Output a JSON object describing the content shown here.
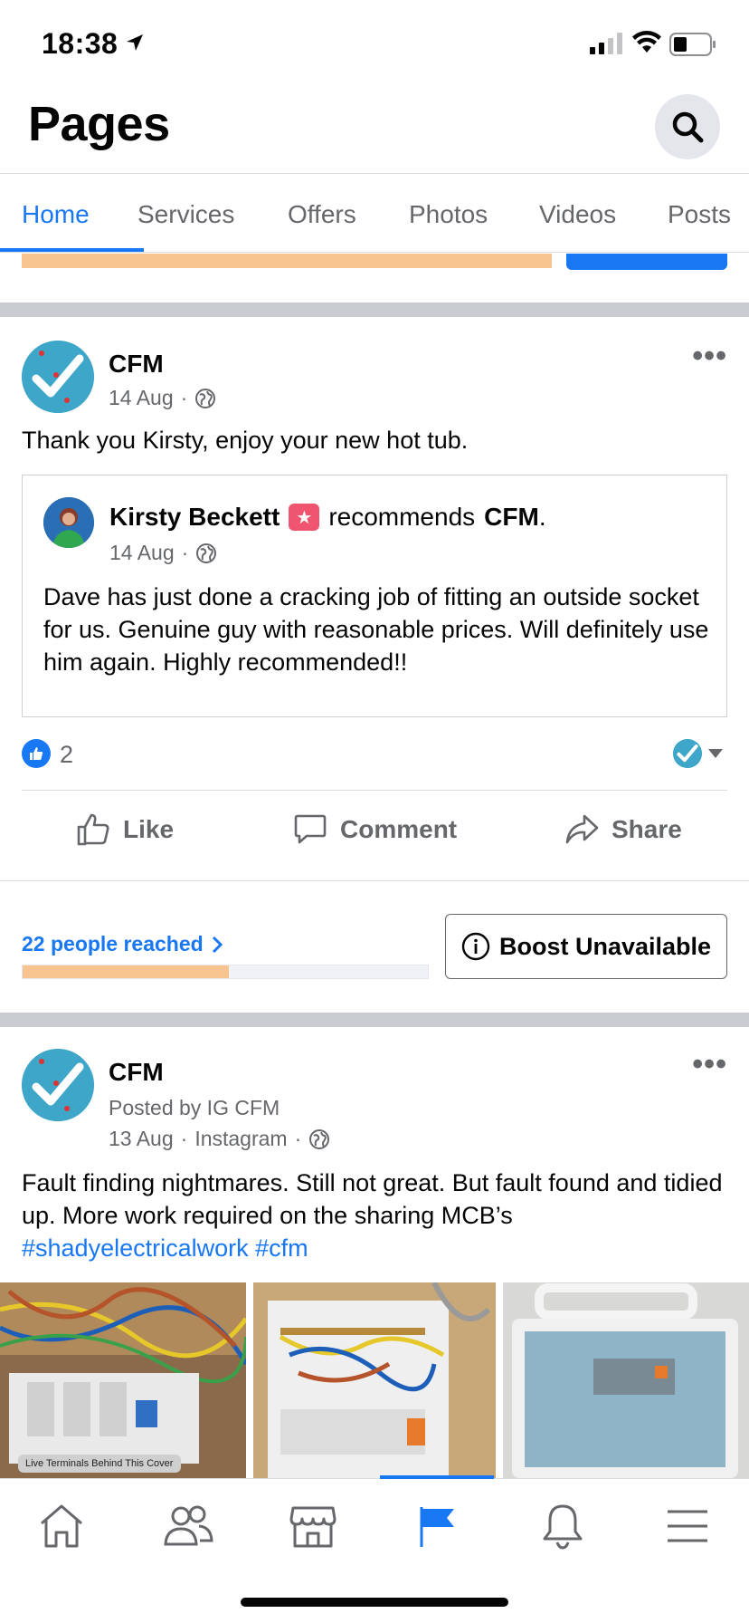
{
  "status_bar": {
    "time": "18:38"
  },
  "header": {
    "title": "Pages"
  },
  "tabs": [
    {
      "label": "Home"
    },
    {
      "label": "Services"
    },
    {
      "label": "Offers"
    },
    {
      "label": "Photos"
    },
    {
      "label": "Videos"
    },
    {
      "label": "Posts"
    }
  ],
  "post1": {
    "author": "CFM",
    "date": "14 Aug",
    "text": "Thank you Kirsty, enjoy your new hot tub.",
    "recommendation": {
      "name": "Kirsty Beckett",
      "verb": "recommends",
      "page": "CFM",
      "date": "14 Aug",
      "text": "Dave has just done a cracking job of fitting an outside socket for us. Genuine guy with reasonable prices. Will definitely use him again. Highly recommended!!"
    },
    "reactions": {
      "like_count": "2"
    },
    "actions": {
      "like": "Like",
      "comment": "Comment",
      "share": "Share"
    },
    "insights": {
      "reached": "22 people reached",
      "reach_progress": 0.51,
      "boost": "Boost Unavailable"
    }
  },
  "post2": {
    "author": "CFM",
    "posted_by": "Posted by IG CFM",
    "date": "13 Aug",
    "source": "Instagram",
    "text": "Fault finding nightmares. Still not great. But fault found and tidied up. More work required on the sharing MCB’s",
    "hashtags": [
      "#shadyelectricalwork",
      "#cfm"
    ],
    "photo1_caption": "Live Terminals Behind This Cover"
  },
  "colors": {
    "accent": "#1877f2",
    "reach_fill": "#f7c48f"
  }
}
